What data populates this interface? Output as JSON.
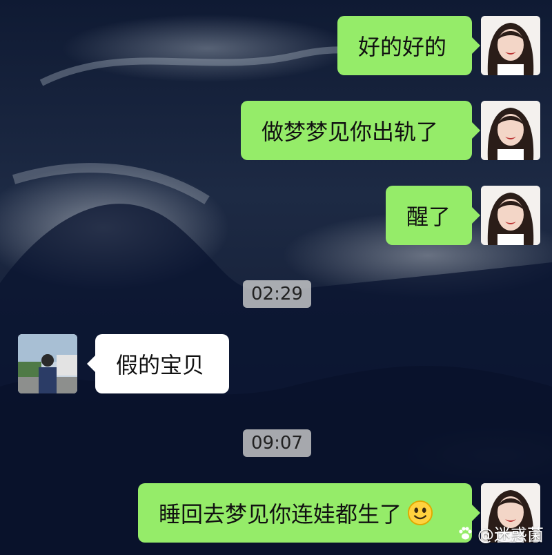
{
  "messages": [
    {
      "text": "好的好的"
    },
    {
      "text": "做梦梦见你出轨了"
    },
    {
      "text": "醒了"
    },
    {
      "text": "假的宝贝"
    },
    {
      "text": "睡回去梦见你连娃都生了"
    }
  ],
  "timestamps": [
    "02:29",
    "09:07"
  ],
  "emoji": {
    "name": "smile-emoji-icon"
  },
  "watermark": {
    "text": "@迷惑菌",
    "icon": "paw-icon"
  },
  "colors": {
    "outgoing_bubble": "#95ec69",
    "incoming_bubble": "#ffffff",
    "timestamp_bg": "#d2d2d2"
  }
}
